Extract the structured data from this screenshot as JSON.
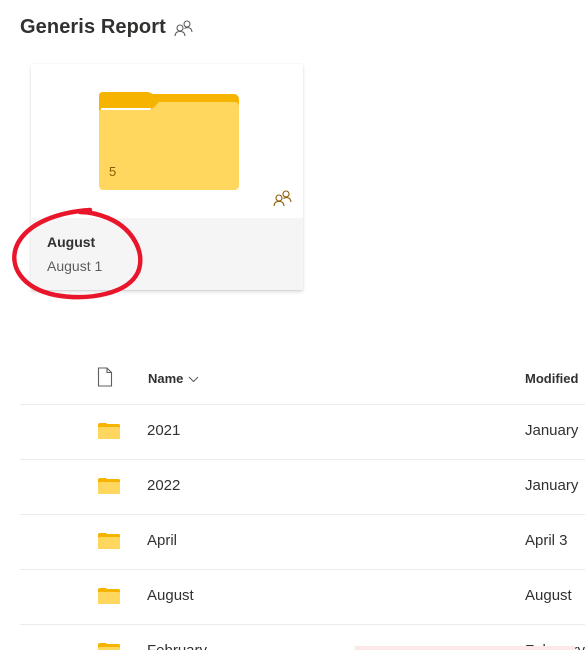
{
  "header": {
    "title": "Generis Report",
    "share_icon": "people-share-icon"
  },
  "card": {
    "folder_icon": "folder-icon",
    "item_count": "5",
    "shared_icon": "people-share-icon",
    "name": "August",
    "date": "August 1",
    "annotation": "red-hand-drawn-circle"
  },
  "list": {
    "columns": {
      "type_icon": "file-type-icon",
      "name": "Name",
      "name_sort_icon": "chevron-down-icon",
      "modified": "Modified"
    },
    "rows": [
      {
        "name": "2021",
        "modified": "January",
        "icon": "folder-icon"
      },
      {
        "name": "2022",
        "modified": "January",
        "icon": "folder-icon"
      },
      {
        "name": "April",
        "modified": "April 3",
        "icon": "folder-icon"
      },
      {
        "name": "August",
        "modified": "August",
        "icon": "folder-icon"
      },
      {
        "name": "February",
        "modified": "February",
        "icon": "folder-icon"
      }
    ]
  },
  "colors": {
    "folder_yellow": "#ffd75e",
    "folder_tab": "#f6b400",
    "annotation_red": "#e8152b",
    "card_footer": "#f5f5f5"
  }
}
